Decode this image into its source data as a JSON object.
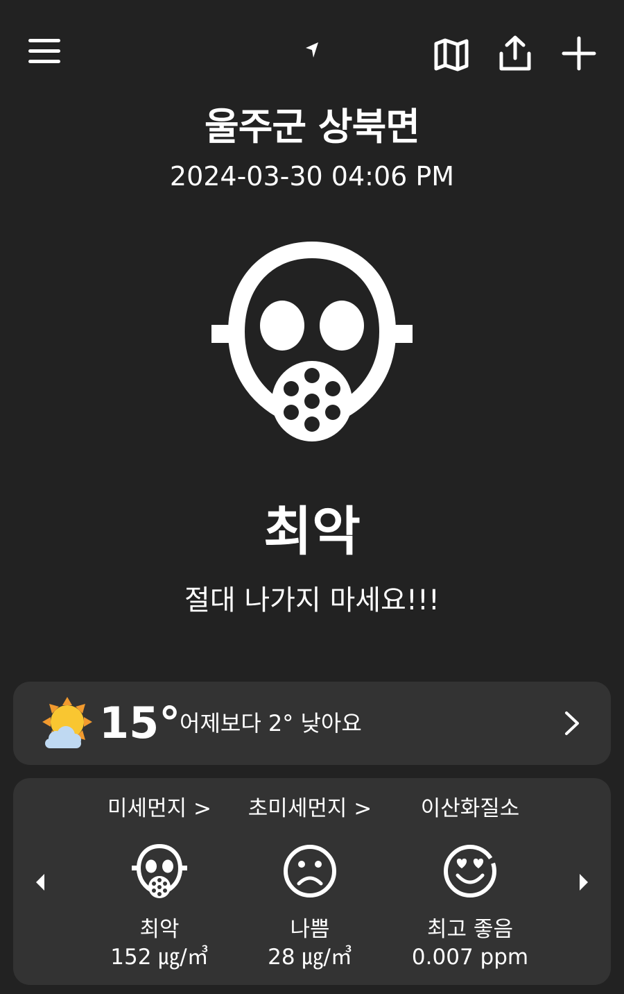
{
  "header": {
    "location": "울주군 상북면",
    "timestamp": "2024-03-30 04:06 PM",
    "icons": [
      "menu-icon",
      "location-arrow-icon",
      "map-icon",
      "share-icon",
      "add-icon"
    ]
  },
  "status": {
    "icon": "gas-mask-icon",
    "grade": "최악",
    "message": "절대 나가지 마세요!!!"
  },
  "weather": {
    "icon": "partly-sunny-icon",
    "temperature": "15°",
    "comparison": "어제보다 2° 낮아요"
  },
  "pollutants": [
    {
      "title": "미세먼지 >",
      "icon": "gas-mask-icon",
      "grade": "최악",
      "value": "152 ㎍/㎥"
    },
    {
      "title": "초미세먼지 >",
      "icon": "sad-face-icon",
      "grade": "나쁨",
      "value": "28 ㎍/㎥"
    },
    {
      "title": "이산화질소",
      "icon": "heart-eyes-face-icon",
      "grade": "최고 좋음",
      "value": "0.007 ppm"
    }
  ],
  "colors": {
    "background": "#222222",
    "card": "#333333",
    "text": "#ffffff",
    "sun": "#F9C631",
    "sun_rays": "#F29A2E",
    "cloud": "#BFD9F2"
  }
}
